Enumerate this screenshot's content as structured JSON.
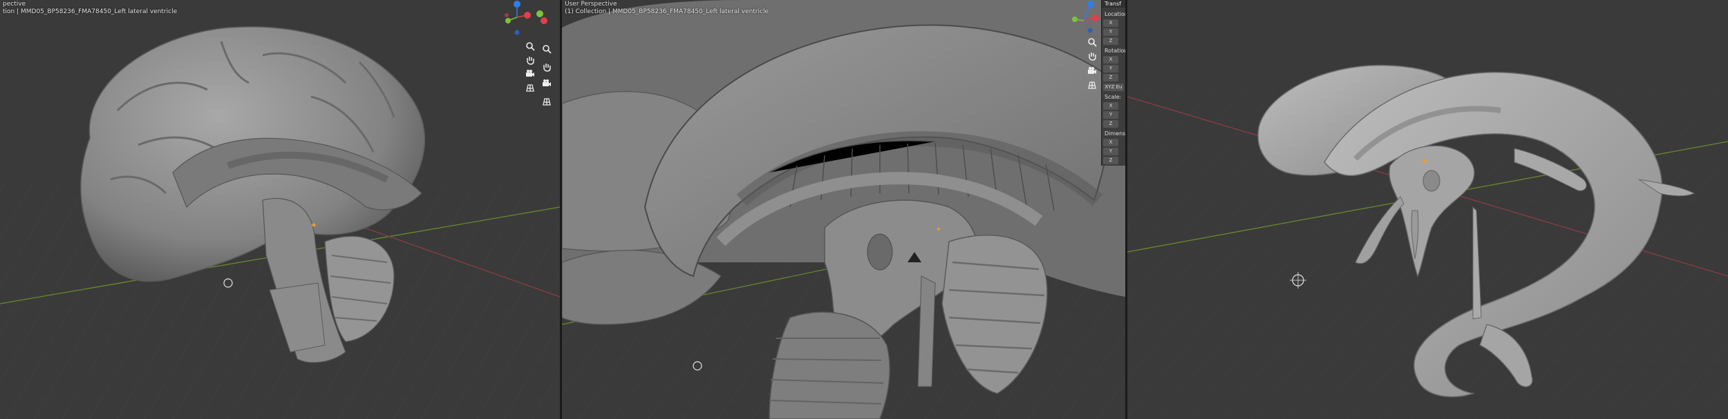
{
  "viewports": [
    {
      "title": "pective",
      "subtitle": "tion | MMD05_BP58236_FMA78450_Left lateral ventricle"
    },
    {
      "title": "User Perspective",
      "subtitle": "(1) Collection | MMD05_BP58236_FMA78450_Left lateral ventricle"
    },
    {
      "title": "",
      "subtitle": ""
    }
  ],
  "gizmo": {
    "x": "X",
    "y": "Y",
    "z": "Z",
    "colors": {
      "x": "#e0404a",
      "y": "#7ec23a",
      "z": "#2f7fe8",
      "neg": "#5a7fc4"
    }
  },
  "nav_icons": [
    "zoom-icon",
    "pan-hand-icon",
    "camera-icon",
    "grid-icon"
  ],
  "npanel": {
    "header": "Transf",
    "location_label": "Location:",
    "rotation_label": "Rotation:",
    "rotation_mode": "XYZ Eu",
    "scale_label": "Scale:",
    "dimensions_label": "Dimensio",
    "axes": [
      "X",
      "Y",
      "Z"
    ]
  },
  "colors": {
    "background": "#3a3a3a",
    "mesh": "#8e8e8e",
    "mesh_shadow": "#5e5e5e",
    "axis_x_line": "#8a3d45",
    "axis_y_line": "#6b8a2c",
    "origin_dot": "#e8a030"
  }
}
